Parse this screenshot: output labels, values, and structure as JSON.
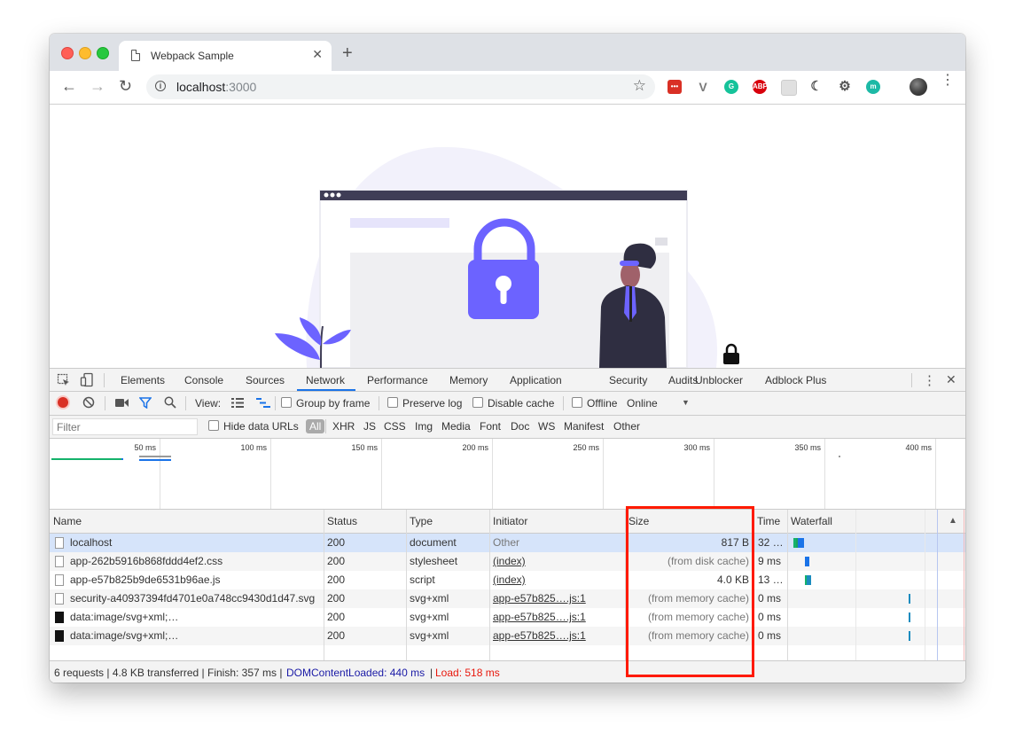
{
  "browser": {
    "tab_title": "Webpack Sample",
    "url_host": "localhost",
    "url_port": ":3000",
    "icons": {
      "back": "←",
      "forward": "→",
      "reload": "↻",
      "star": "☆",
      "new_tab": "+",
      "close": "✕",
      "menu": "⋮"
    },
    "extensions": [
      {
        "name": "todo-ext-icon",
        "color": "#d93025",
        "label": "•••"
      },
      {
        "name": "vue-ext-icon",
        "color": "#7a7a7a",
        "label": "V"
      },
      {
        "name": "grammarly-ext-icon",
        "color": "#15c39a",
        "label": "G"
      },
      {
        "name": "abp-ext-icon",
        "color": "#d8000c",
        "label": "ABP"
      },
      {
        "name": "grid-ext-icon",
        "color": "#e0e0e0",
        "label": ""
      },
      {
        "name": "moon-ext-icon",
        "color": "#555555",
        "label": "☾"
      },
      {
        "name": "settings-ext-icon",
        "color": "#555555",
        "label": "⚙"
      },
      {
        "name": "m-ext-icon",
        "color": "#1db9a6",
        "label": "m"
      }
    ]
  },
  "devtools": {
    "tabs": [
      "Elements",
      "Console",
      "Sources",
      "Network",
      "Performance",
      "Memory",
      "Application",
      "Security",
      "Audits",
      "Unblocker",
      "Adblock Plus"
    ],
    "active_tab": "Network",
    "controls": {
      "view_label": "View:",
      "group_by_frame": "Group by frame",
      "preserve_log": "Preserve log",
      "disable_cache": "Disable cache",
      "offline": "Offline",
      "throttle": "Online"
    },
    "filter": {
      "placeholder": "Filter",
      "hide_data_urls": "Hide data URLs",
      "types": [
        "All",
        "XHR",
        "JS",
        "CSS",
        "Img",
        "Media",
        "Font",
        "Doc",
        "WS",
        "Manifest",
        "Other"
      ]
    },
    "overview_ticks": [
      "50 ms",
      "100 ms",
      "150 ms",
      "200 ms",
      "250 ms",
      "300 ms",
      "350 ms",
      "400 ms"
    ],
    "table": {
      "columns": [
        "Name",
        "Status",
        "Type",
        "Initiator",
        "Size",
        "Time",
        "Waterfall"
      ],
      "rows": [
        {
          "name": "localhost",
          "status": "200",
          "type": "document",
          "initiator": "Other",
          "size": "817 B",
          "time": "32 …",
          "icon": "doc",
          "initiator_link": false
        },
        {
          "name": "app-262b5916b868fddd4ef2.css",
          "status": "200",
          "type": "stylesheet",
          "initiator": "(index)",
          "size": "(from disk cache)",
          "time": "9 ms",
          "icon": "doc",
          "initiator_link": true
        },
        {
          "name": "app-e57b825b9de6531b96ae.js",
          "status": "200",
          "type": "script",
          "initiator": "(index)",
          "size": "4.0 KB",
          "time": "13 …",
          "icon": "doc",
          "initiator_link": true
        },
        {
          "name": "security-a40937394fd4701e0a748cc9430d1d47.svg",
          "status": "200",
          "type": "svg+xml",
          "initiator": "app-e57b825….js:1",
          "size": "(from memory cache)",
          "time": "0 ms",
          "icon": "svg",
          "initiator_link": true
        },
        {
          "name": "data:image/svg+xml;…",
          "status": "200",
          "type": "svg+xml",
          "initiator": "app-e57b825….js:1",
          "size": "(from memory cache)",
          "time": "0 ms",
          "icon": "dark",
          "initiator_link": true
        },
        {
          "name": "data:image/svg+xml;…",
          "status": "200",
          "type": "svg+xml",
          "initiator": "app-e57b825….js:1",
          "size": "(from memory cache)",
          "time": "0 ms",
          "icon": "lock",
          "initiator_link": true
        }
      ]
    },
    "status_bar": {
      "summary": "6 requests | 4.8 KB transferred | Finish: 357 ms |",
      "dom_content_loaded": "DOMContentLoaded: 440 ms",
      "divider": "|",
      "load": "Load: 518 ms"
    }
  },
  "colors": {
    "accent": "#1a73e8",
    "illustration_purple": "#6c63ff",
    "dom_blue": "#1a1aa6",
    "load_red": "#e8170c",
    "highlight_red": "#ff1a00"
  }
}
